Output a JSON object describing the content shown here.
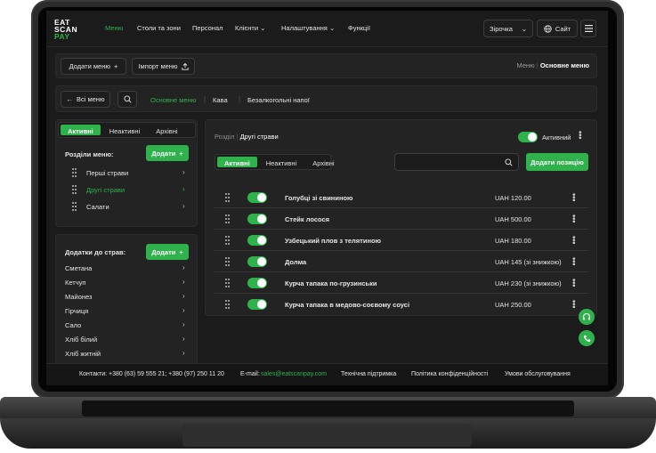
{
  "logo": {
    "line1": "EAT",
    "line2": "SCAN",
    "line3": "PAY"
  },
  "nav": {
    "items": [
      {
        "label": "Меню",
        "active": true
      },
      {
        "label": "Столи та зони"
      },
      {
        "label": "Персонал"
      },
      {
        "label": "Клієнти",
        "dropdown": true
      },
      {
        "label": "Налаштування",
        "dropdown": true
      },
      {
        "label": "Функції"
      }
    ],
    "restaurant_select": "Зірочка",
    "site_label": "Сайт"
  },
  "toolbar": {
    "add_menu": "Додати меню",
    "import_menu": "Імпорт меню",
    "breadcrumb_root": "Меню",
    "breadcrumb_current": "Основне меню"
  },
  "menu_bar": {
    "back": "Всі меню",
    "menus": [
      "Основне меню",
      "Кава",
      "Безалкогольні напої"
    ]
  },
  "sections_panel": {
    "tabs": [
      "Активні",
      "Неактивні",
      "Архівні"
    ],
    "title": "Розділи меню:",
    "add": "Додати",
    "items": [
      {
        "label": "Перші страви"
      },
      {
        "label": "Другі страви",
        "active": true
      },
      {
        "label": "Салати"
      }
    ]
  },
  "addons_panel": {
    "title": "Додатки до страв:",
    "add": "Додати",
    "items": [
      "Сметана",
      "Кетчуп",
      "Майонез",
      "Гірчиця",
      "Сало",
      "Хліб білий",
      "Хліб житній"
    ]
  },
  "main": {
    "breadcrumb_root": "Розділ",
    "breadcrumb_current": "Другі страви",
    "status": "Активний",
    "tabs": [
      "Активні",
      "Неактивні",
      "Архівні"
    ],
    "search_placeholder": "",
    "add_position": "Додати позицію",
    "rows": [
      {
        "name": "Голубці зі свининою",
        "price": "UAH 120.00"
      },
      {
        "name": "Стейк лосося",
        "price": "UAH 500.00"
      },
      {
        "name": "Узбецький плов з телятиною",
        "price": "UAH 180.00"
      },
      {
        "name": "Долма",
        "price": "UAH 145 (зі знижкою)"
      },
      {
        "name": "Курча тапака по-грузинськи",
        "price": "UAH 230 (зі знижкою)"
      },
      {
        "name": "Курча тапака в медово-соєвому соусі",
        "price": "UAH 250.00"
      }
    ]
  },
  "footer": {
    "contacts": "Контакти: +380 (63) 59 555 21; +380 (97) 250 11 20",
    "email_label": "E-mail:",
    "email": "sales@eatscanpay.com",
    "support": "Технічна підтримка",
    "privacy": "Політика конфіденційності",
    "terms": "Умови обслуговування"
  },
  "colors": {
    "accent": "#2fb14c",
    "background": "#1b1b1b",
    "panel": "#232323"
  }
}
